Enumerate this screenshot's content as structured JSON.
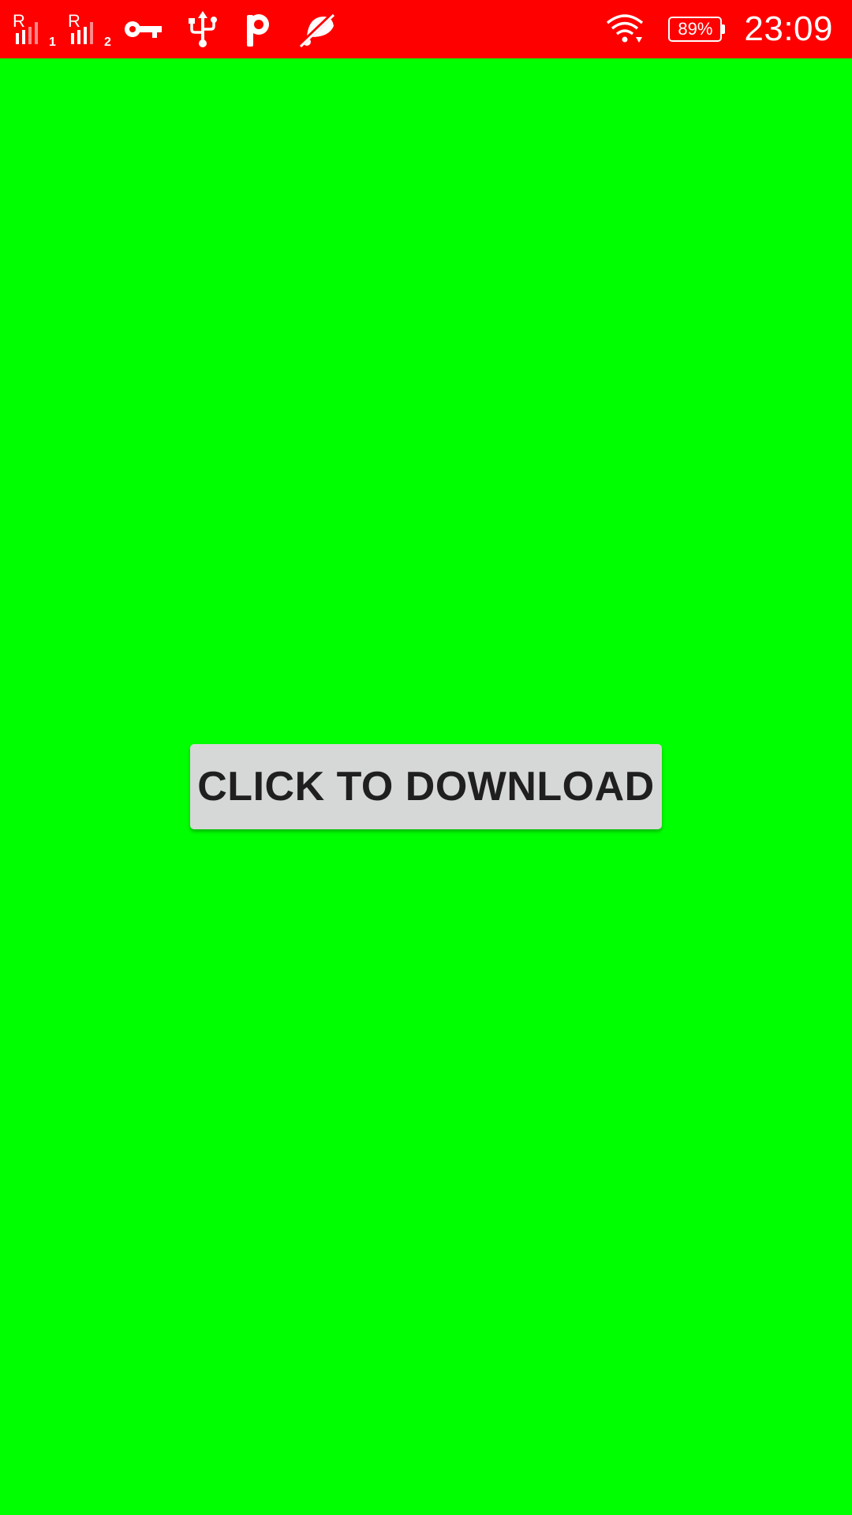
{
  "status_bar": {
    "background_color": "#ff0000",
    "sim1": {
      "label": "R",
      "slot": "1",
      "icon": "signal-roaming-icon"
    },
    "sim2": {
      "label": "R",
      "slot": "2",
      "icon": "signal-roaming-icon"
    },
    "icons_left": [
      "vpn-key-icon",
      "usb-icon",
      "p-notification-icon",
      "mute-notifications-icon"
    ],
    "wifi_icon": "wifi-icon",
    "battery": {
      "percent_label": "89%",
      "level": 0.89
    },
    "time": "23:09"
  },
  "main": {
    "background_color": "#00ff00",
    "download_button": {
      "label": "CLICK TO DOWNLOAD",
      "color": "#d6d7d7"
    }
  }
}
